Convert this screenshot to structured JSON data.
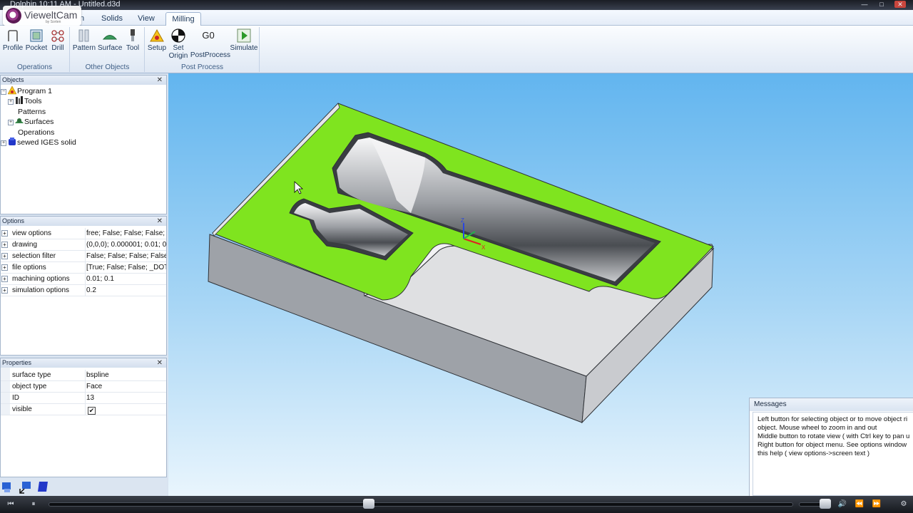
{
  "window": {
    "title": "Dolphin 10:11 AM - Untitled.d3d",
    "controls": [
      "—",
      "□",
      "✕"
    ]
  },
  "logo": {
    "name": "VieweltCam",
    "sub": "by Sorten"
  },
  "tabs": [
    {
      "label": "n",
      "active": false
    },
    {
      "label": "Solids",
      "active": false
    },
    {
      "label": "View",
      "active": false
    },
    {
      "label": "Milling",
      "active": true
    }
  ],
  "ribbon": {
    "groups": [
      {
        "label": "Operations",
        "buttons": [
          "Profile",
          "Pocket",
          "Drill"
        ]
      },
      {
        "label": "Other Objects",
        "buttons": [
          "Pattern",
          "Surface",
          "Tool"
        ]
      },
      {
        "label": "Post Process",
        "buttons": [
          "Setup",
          "Set Origin",
          "G0",
          "PostProcess",
          "Simulate"
        ]
      }
    ],
    "g0_text": "G0"
  },
  "objects_panel": {
    "title": "Objects",
    "close": "✕",
    "tree": [
      {
        "label": "Program 1",
        "icon": "warning-icon"
      },
      {
        "label": "Tools",
        "icon": "tools-icon"
      },
      {
        "label": "Patterns",
        "icon": ""
      },
      {
        "label": "Surfaces",
        "icon": "surfaces-icon"
      },
      {
        "label": "Operations",
        "icon": ""
      },
      {
        "label": "sewed IGES solid",
        "icon": "solid-icon"
      }
    ]
  },
  "options_panel": {
    "title": "Options",
    "close": "✕",
    "rows": [
      {
        "name": "view options",
        "value": "free; False; False; False; Tru"
      },
      {
        "name": "drawing",
        "value": "(0,0,0); 0.000001; 0.01; 0.1; 0"
      },
      {
        "name": "selection filter",
        "value": "False; False; False; False; Fa"
      },
      {
        "name": "file options",
        "value": "[True; False; False; _DOT_; _D"
      },
      {
        "name": "machining options",
        "value": "0.01; 0.1"
      },
      {
        "name": "simulation options",
        "value": "0.2"
      }
    ]
  },
  "properties_panel": {
    "title": "Properties",
    "close": "✕",
    "rows": [
      {
        "name": "surface type",
        "value": "bspline"
      },
      {
        "name": "object type",
        "value": "Face"
      },
      {
        "name": "ID",
        "value": "13"
      },
      {
        "name": "visible",
        "value": "✔"
      }
    ]
  },
  "messages": {
    "title": "Messages",
    "lines": [
      "Left button for selecting object or to move object ri",
      "object. Mouse wheel to zoom in and out",
      "Middle button to rotate view ( with Ctrl key to pan u",
      "Right button for object menu. See options window",
      "this help ( view options->screen text )"
    ]
  },
  "axis": {
    "z": "Z",
    "x": "X"
  },
  "colors": {
    "ribbon_text": "#1e395b",
    "selected_face": "#7fe41f",
    "part_side": "#c9cbcf",
    "viewport_top": "#62b5ef",
    "viewport_bottom": "#e9f5fd"
  },
  "player": {
    "progress": 0.43,
    "volume": 0.85,
    "buttons": [
      "⏮",
      "⏸",
      "🔊",
      "⏪",
      "⏩",
      "⏭",
      "⚙"
    ]
  }
}
